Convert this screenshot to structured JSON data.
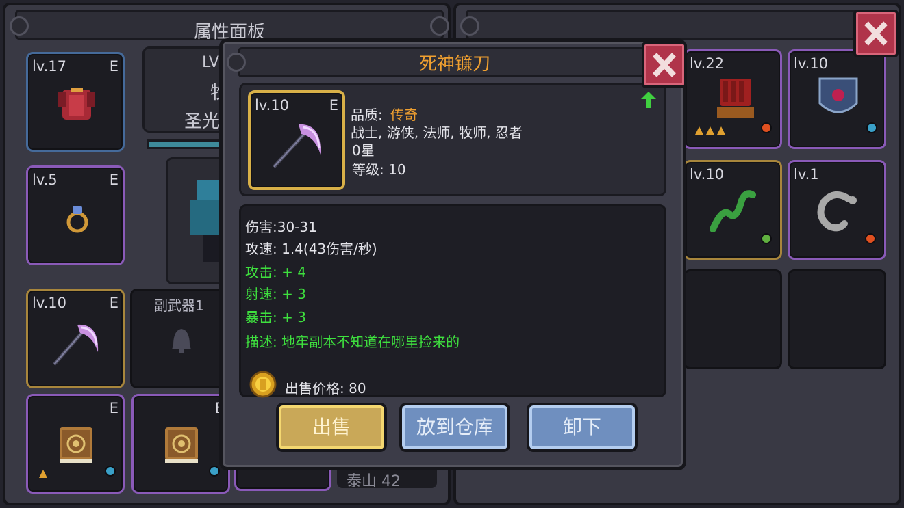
{
  "left_panel": {
    "title": "属性面板",
    "char_header_partial": "LV",
    "char_line2_partial": "牧",
    "char_line3_partial": "圣光",
    "side_weapon_label": "副武器1",
    "bottom_partial_text": "泰山  42",
    "slots": [
      {
        "level": "lv.17",
        "tag": "E"
      },
      {
        "level": "lv.5",
        "tag": "E"
      },
      {
        "level": "lv.10",
        "tag": "E"
      },
      {
        "level": "",
        "tag": "E"
      },
      {
        "level": "",
        "tag": "E"
      }
    ]
  },
  "right_panel": {
    "slots": [
      {
        "level": "lv.22"
      },
      {
        "level": "lv.10"
      },
      {
        "level": "lv.10"
      },
      {
        "level": "lv.1"
      }
    ]
  },
  "item_dialog": {
    "title": "死神镰刀",
    "item_level": "lv.10",
    "item_tag": "E",
    "quality_label": "品质: ",
    "quality_value": "传奇",
    "classes": "战士, 游侠, 法师, 牧师, 忍者",
    "stars": "0星",
    "level_req": "等级: 10",
    "damage": "伤害:30-31",
    "attack_speed": "攻速: 1.4(43伤害/秒)",
    "bonus_attack": "攻击: + 4",
    "bonus_shoot_speed": "射速: + 3",
    "bonus_crit": "暴击: + 3",
    "description": "描述: 地牢副本不知道在哪里捡来的",
    "sell_price": "出售价格: 80",
    "btn_sell": "出售",
    "btn_store": "放到仓库",
    "btn_unequip": "卸下"
  },
  "colors": {
    "legendary": "#f0a030",
    "bonus_green": "#3ee03e",
    "text_light": "#e4e4ea"
  }
}
